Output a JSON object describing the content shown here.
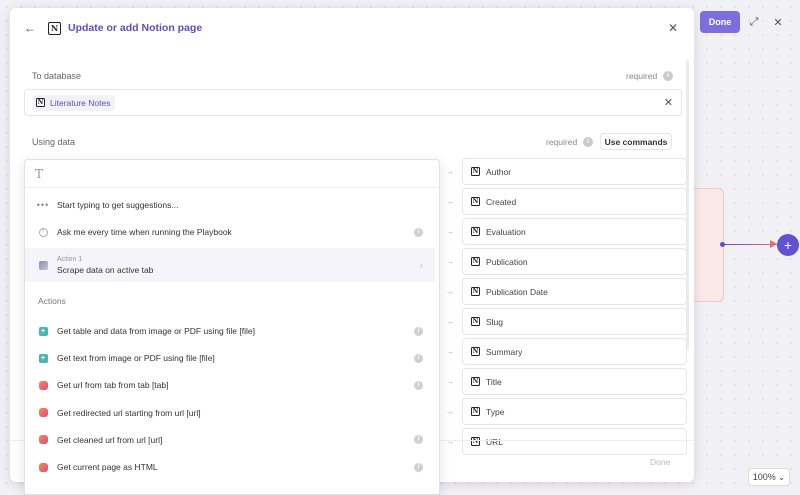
{
  "toolbar": {
    "done_label": "Done",
    "expand_icon": "expand-icon",
    "close_icon": "close-icon"
  },
  "zoom": {
    "level": "100%"
  },
  "modal": {
    "title": "Update or add Notion page",
    "to_database": {
      "label": "To database",
      "required": "required",
      "selected": "Literature Notes"
    },
    "using_data": {
      "label": "Using data",
      "required": "required",
      "use_commands_label": "Use commands"
    },
    "properties": [
      "Author",
      "Created",
      "Evaluation",
      "Publication",
      "Publication Date",
      "Slug",
      "Summary",
      "Title",
      "Type",
      "URL"
    ],
    "footer_done_label": "Done"
  },
  "dropdown": {
    "input_icon": "text-type-icon",
    "suggestions_hint": "Start typing to get suggestions...",
    "ask_me": "Ask me every time when running the Playbook",
    "action_sublabel": "Action 1",
    "action_label": "Scrape data on active tab",
    "actions_heading": "Actions",
    "actions": [
      "Get table and data from image or PDF using file [file]",
      "Get text from image or PDF using file [file]",
      "Get url from tab from tab [tab]",
      "Get redirected url starting from url [url]",
      "Get cleaned url from url [url]",
      "Get current page as HTML"
    ]
  },
  "colors": {
    "accent": "#5a4fc4",
    "done_button": "#7a6ee0",
    "canvas_add": "#6152d4"
  }
}
